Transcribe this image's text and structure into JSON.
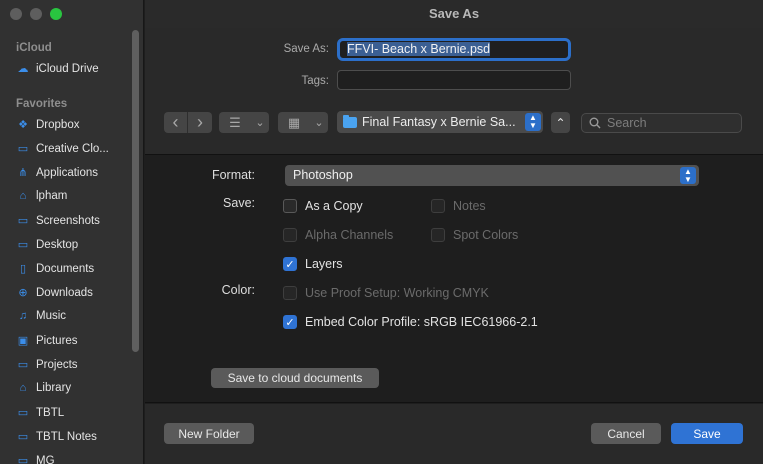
{
  "window": {
    "title": "Save As"
  },
  "sidebar": {
    "sections": [
      {
        "title": "iCloud",
        "items": [
          {
            "label": "iCloud Drive",
            "icon": "cloud-icon"
          }
        ]
      },
      {
        "title": "Favorites",
        "items": [
          {
            "label": "Dropbox",
            "icon": "dropbox-icon"
          },
          {
            "label": "Creative Clo...",
            "icon": "folder-icon"
          },
          {
            "label": "Applications",
            "icon": "applications-icon"
          },
          {
            "label": "lpham",
            "icon": "home-icon"
          },
          {
            "label": "Screenshots",
            "icon": "folder-icon"
          },
          {
            "label": "Desktop",
            "icon": "desktop-icon"
          },
          {
            "label": "Documents",
            "icon": "document-icon"
          },
          {
            "label": "Downloads",
            "icon": "download-icon"
          },
          {
            "label": "Music",
            "icon": "music-icon"
          },
          {
            "label": "Pictures",
            "icon": "pictures-icon"
          },
          {
            "label": "Projects",
            "icon": "folder-icon"
          },
          {
            "label": "Library",
            "icon": "library-icon"
          },
          {
            "label": "TBTL",
            "icon": "folder-icon"
          },
          {
            "label": "TBTL Notes",
            "icon": "folder-icon"
          },
          {
            "label": "MG",
            "icon": "folder-icon"
          }
        ]
      }
    ]
  },
  "save_as": {
    "label": "Save As:",
    "value": "FFVI- Beach x Bernie.psd"
  },
  "tags": {
    "label": "Tags:",
    "value": ""
  },
  "nav": {
    "back_glyph": "‹",
    "forward_glyph": "›",
    "list_glyph": "☰",
    "grid_glyph": "▦",
    "chevron": "⌄",
    "folder_name": "Final Fantasy x Bernie Sa...",
    "expand_glyph": "⌃"
  },
  "search": {
    "placeholder": "Search"
  },
  "format": {
    "label": "Format:",
    "value": "Photoshop"
  },
  "save_opts": {
    "label": "Save:",
    "as_a_copy": {
      "label": "As a Copy",
      "checked": false,
      "enabled": true
    },
    "notes": {
      "label": "Notes",
      "checked": false,
      "enabled": false
    },
    "alpha_channels": {
      "label": "Alpha Channels",
      "checked": false,
      "enabled": false
    },
    "spot_colors": {
      "label": "Spot Colors",
      "checked": false,
      "enabled": false
    },
    "layers": {
      "label": "Layers",
      "checked": true,
      "enabled": true
    }
  },
  "color_opts": {
    "label": "Color:",
    "use_proof_setup": {
      "label": "Use Proof Setup:  Working CMYK",
      "checked": false,
      "enabled": false
    },
    "embed_color_profile": {
      "label": "Embed Color Profile:  sRGB IEC61966-2.1",
      "checked": true,
      "enabled": true
    }
  },
  "buttons": {
    "cloud": "Save to cloud documents",
    "new_folder": "New Folder",
    "cancel": "Cancel",
    "save": "Save"
  },
  "colors": {
    "accent": "#2f73d4",
    "folder": "#4aa3f0",
    "zoom": "#29c540"
  }
}
